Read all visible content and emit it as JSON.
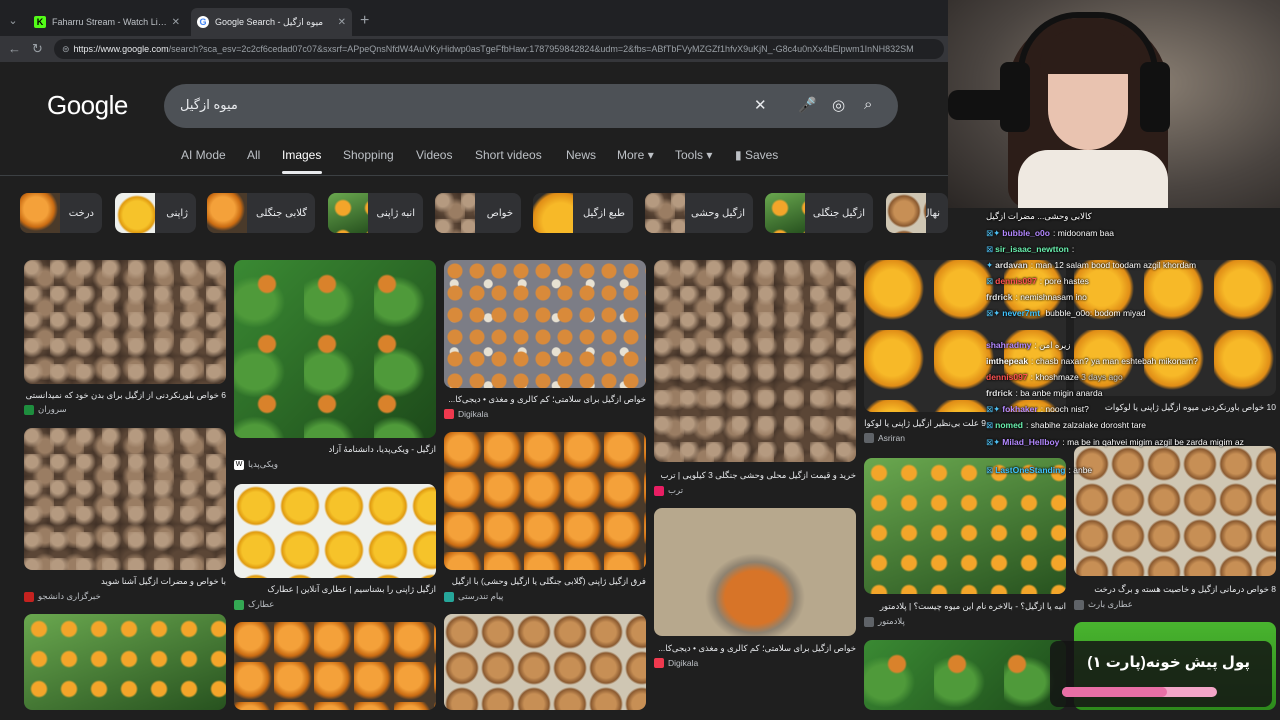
{
  "browser": {
    "tabs": [
      {
        "label": "Faharru Stream - Watch Live on Ki",
        "favicon": "kick-icon"
      },
      {
        "label": "Google Search - میوه ازگیل",
        "favicon": "google-icon",
        "active": true
      }
    ],
    "url_host": "https://www.google.com",
    "url_rest": "/search?sca_esv=2c2cf6cedad07c07&sxsrf=APpeQnsNfdW4AuVKyHidwp0asTgeFfbHaw:1787959842824&udm=2&fbs=ABfTbFVyMZGZf1hfvX9uKjN_-G8c4u0nXx4bElpwm1InNH832SM"
  },
  "google": {
    "logo": "Google",
    "query": "میوه ازگیل",
    "tabs": [
      {
        "label": "AI Mode"
      },
      {
        "label": "All"
      },
      {
        "label": "Images",
        "active": true
      },
      {
        "label": "Shopping"
      },
      {
        "label": "Videos"
      },
      {
        "label": "Short videos"
      },
      {
        "label": "News"
      },
      {
        "label": "More"
      },
      {
        "label": "Tools"
      },
      {
        "label": "Saves"
      }
    ],
    "chips": [
      "درخت",
      "ژاپنی",
      "گلابی جنگلی",
      "انبه ژاپنی",
      "خواص",
      "طبع ازگیل",
      "ازگیل وحشی",
      "ازگیل جنگلی",
      "نهال ازگیل"
    ],
    "results": [
      {
        "caption": "6 خواص بلورنکردنی از ازگیل برای بدن خود که نمیدانستی",
        "source": "سروران"
      },
      {
        "caption": "ازگیل - ویکی‌پدیا، دانشنامهٔ آزاد",
        "source": "ویکی‌پدیا"
      },
      {
        "caption": "خواص ازگیل برای سلامتی؛ کم کالری و مغذی • دیجی‌کا...",
        "source": "Digikala"
      },
      {
        "caption": "خرید و قیمت ازگیل محلی وحشی جنگلی 3 کیلویی | ترب",
        "source": "ترب"
      },
      {
        "caption": "9 علت بی‌نظیر ازگیل ژاپنی یا لوکوات",
        "source": "Asriran"
      },
      {
        "caption": "10 خواص باورنکردنی میوه ازگیل ژاپنی یا لوکوات",
        "source": ""
      },
      {
        "caption": "با خواص و مضرات ازگیل آشنا شوید",
        "source": "خبرگزاری دانشجو"
      },
      {
        "caption": "ازگیل ژاپنی را بشناسیم | عطاری آنلاین | عطارک",
        "source": "عطارک"
      },
      {
        "caption": "فرق ازگیل ژاپنی (گلابی جنگلی یا ازگیل وحشی) با ازگیل",
        "source": "پیام تندرستی"
      },
      {
        "caption": "خواص ازگیل برای سلامتی؛ کم کالری و مغذی • دیجی‌کا...",
        "source": "Digikala"
      },
      {
        "caption": "انبه یا ازگیل؟ - بالاخره نام این میوه چیست؟ | پلادمتور",
        "source": "پلادمتور"
      },
      {
        "caption": "8 خواص درمانی ازگیل و خاصیت هسته و برگ درخت",
        "source": "عطاری بارث"
      }
    ]
  },
  "chat": [
    {
      "user": "",
      "text": "کالابی وحشی...  مضرات ازگیل"
    },
    {
      "user": "bubble_o0o",
      "text": "midoonam baa"
    },
    {
      "user": "sir_isaac_newtton",
      "text": ":"
    },
    {
      "user": "ardavan",
      "text": "man 12 salam bood toodam azgil khordam"
    },
    {
      "user": "dennis097",
      "text": "pore hastes"
    },
    {
      "user": "frdrick",
      "text": "nemishnasam ino"
    },
    {
      "user": "never7mt",
      "text": "bubble_o0o: bodom miyad"
    },
    {
      "user": "shahradmy",
      "text": "زیره امن"
    },
    {
      "user": "imthepeak",
      "text": "chasb naxan? ya man eshtebah mikonam?"
    },
    {
      "user": "dennis097",
      "text": "khoshmaze"
    },
    {
      "user": "frdrick",
      "text": "ba anbe migin anarda"
    },
    {
      "user": "fokhaker",
      "text": "nooch nist?"
    },
    {
      "user": "nomed",
      "text": "shabihe zalzalake dorosht tare"
    },
    {
      "user": "Milad_Hellboy",
      "text": "ma be in qahvei migim azgil be zarda migim az"
    },
    {
      "user": "LastOneStanding",
      "text": "anbe"
    }
  ],
  "chat_timestamp": "3 days ago",
  "banner": {
    "text": "پول پیش خونه(پارت ۱)",
    "progress": 0.68
  },
  "colors": {
    "bg": "#1f1f1f",
    "accent": "#8ab4f8",
    "chip_bg": "#303134"
  }
}
